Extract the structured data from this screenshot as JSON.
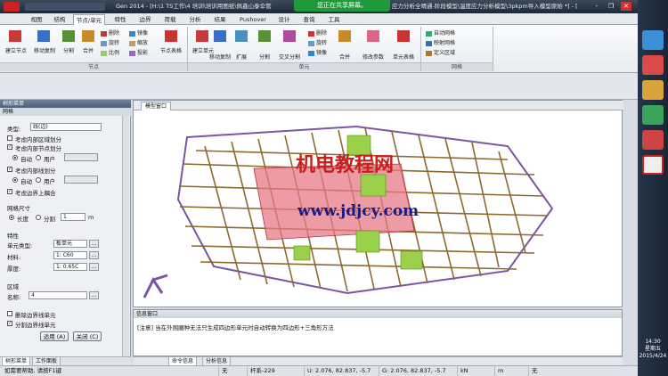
{
  "window": {
    "title_left": "Gen 2014 - [H:\\1 TS工作\\4 培训\\培训用图纸\\佩鑫山泰伞管",
    "title_right": "应力分析全晴通-阶段模型\\温度应力分析模型\\3pkpm导入模型原始 *] - [",
    "share_banner": "您正在共享屏幕。",
    "min": "-",
    "restore": "❐",
    "close": "✕"
  },
  "menu_tabs": [
    "视图",
    "结构",
    "节点/单元",
    "特性",
    "边界",
    "荷载",
    "分析",
    "结果",
    "Pushover",
    "设计",
    "查询",
    "工具"
  ],
  "ribbon": {
    "node_group": {
      "label": "节点",
      "buttons": [
        "建立节点",
        "移动复制",
        "分割",
        "合并"
      ],
      "small": [
        "删除",
        "镜像",
        "旋转",
        "缩放",
        "比例",
        "投影"
      ],
      "table": "节点表格"
    },
    "element_group": {
      "label": "单元",
      "buttons": [
        "建立单元",
        "移动复制",
        "扩展",
        "分割",
        "交叉分割",
        "合并",
        "修改参数",
        "单元表格"
      ],
      "small": [
        "删除",
        "旋转",
        "镜像"
      ]
    },
    "mesh_group": {
      "label": "网格",
      "items": [
        "自动网格",
        "映射网格",
        "定义区域"
      ]
    }
  },
  "left_panel": {
    "header": "树形菜单",
    "subtab": "网格",
    "type_label": "类型:",
    "type_value": "线(边)",
    "opt1": "考虑内部区域划分",
    "opt2": "考虑内部节点划分",
    "auto1": "自动",
    "user1": "用户",
    "opt3": "考虑内部线划分",
    "auto2": "自动",
    "user2": "用户",
    "opt4": "考虑边界上耦合",
    "mesh_size": "网格尺寸",
    "length": "长度",
    "divide": "分割",
    "divide_value": "1",
    "divide_unit": "m",
    "props": "特性",
    "elem_type_label": "单元类型:",
    "elem_type": "板单元",
    "material_label": "材料:",
    "material": "1: C60",
    "thickness_label": "厚度:",
    "thickness": "1: 0.65C",
    "region": "区域",
    "name_label": "名称:",
    "name_value": "4",
    "del_boundary": "删除边界线单元",
    "split_boundary": "分割边界线单元",
    "apply": "适用 (A)",
    "close": "关闭 (C)",
    "bottom_tabs": [
      "树形菜单",
      "工作面板"
    ]
  },
  "viewport": {
    "tab": "模型窗口",
    "watermark_cn": "机电教程网",
    "watermark_url": "www.jdjcy.com"
  },
  "message": {
    "title": "信息窗口",
    "text": "[注意] 当在外围圈种无法只生成四边形单元时自动转换为四边形+三角形方法",
    "tabs": [
      "命令信息",
      "分析信息"
    ]
  },
  "status": {
    "help": "如需要帮助, 请按F1键",
    "none": "无",
    "frame": "杆系-229",
    "u": "U: 2.076, 82.837, -5.7",
    "g": "G: 2.076, 82.837, -5.7",
    "unit": "kN",
    "len": "m",
    "none2": "无"
  },
  "taskbar": {
    "time": "14:30",
    "weekday": "星期五",
    "date": "2015/4/24"
  }
}
